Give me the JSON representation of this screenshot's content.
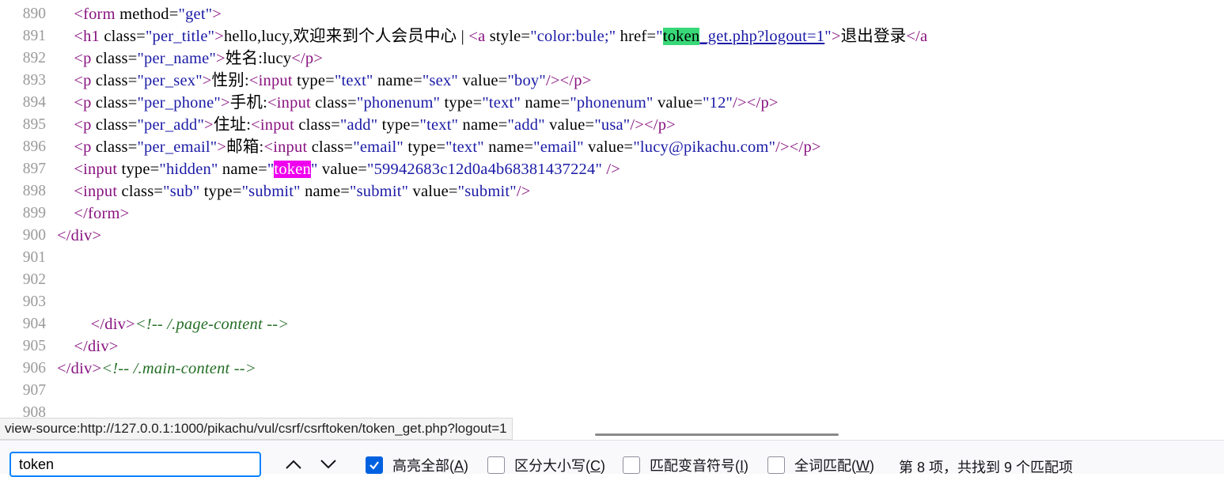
{
  "source_lines": [
    {
      "num": "890",
      "parts": [
        [
          "text",
          "    "
        ],
        [
          "tag",
          "<form "
        ],
        [
          "an",
          "method="
        ],
        [
          "av",
          "\"get\""
        ],
        [
          "tag",
          ">"
        ]
      ]
    },
    {
      "num": "891",
      "parts": [
        [
          "text",
          "    "
        ],
        [
          "tag",
          "<h1 "
        ],
        [
          "an",
          "class="
        ],
        [
          "av",
          "\"per_title\""
        ],
        [
          "tag",
          ">"
        ],
        [
          "text",
          "hello,lucy,欢迎来到个人会员中心 | "
        ],
        [
          "tag",
          "<a "
        ],
        [
          "an",
          "style="
        ],
        [
          "av",
          "\"color:bule;\" "
        ],
        [
          "an",
          "href="
        ],
        [
          "av",
          "\""
        ],
        [
          "hlcur",
          "token"
        ],
        [
          "link",
          "_get.php?logout=1"
        ],
        [
          "av",
          "\""
        ],
        [
          "tag",
          ">"
        ],
        [
          "text",
          "退出登录"
        ],
        [
          "tag",
          "</a"
        ]
      ]
    },
    {
      "num": "892",
      "parts": [
        [
          "text",
          "    "
        ],
        [
          "tag",
          "<p "
        ],
        [
          "an",
          "class="
        ],
        [
          "av",
          "\"per_name\""
        ],
        [
          "tag",
          ">"
        ],
        [
          "text",
          "姓名:lucy"
        ],
        [
          "tag",
          "</p>"
        ]
      ]
    },
    {
      "num": "893",
      "parts": [
        [
          "text",
          "    "
        ],
        [
          "tag",
          "<p "
        ],
        [
          "an",
          "class="
        ],
        [
          "av",
          "\"per_sex\""
        ],
        [
          "tag",
          ">"
        ],
        [
          "text",
          "性别:"
        ],
        [
          "tag",
          "<input "
        ],
        [
          "an",
          "type="
        ],
        [
          "av",
          "\"text\" "
        ],
        [
          "an",
          "name="
        ],
        [
          "av",
          "\"sex\" "
        ],
        [
          "an",
          "value="
        ],
        [
          "av",
          "\"boy\""
        ],
        [
          "tag",
          "/></p>"
        ]
      ]
    },
    {
      "num": "894",
      "parts": [
        [
          "text",
          "    "
        ],
        [
          "tag",
          "<p "
        ],
        [
          "an",
          "class="
        ],
        [
          "av",
          "\"per_phone\""
        ],
        [
          "tag",
          ">"
        ],
        [
          "text",
          "手机:"
        ],
        [
          "tag",
          "<input "
        ],
        [
          "an",
          "class="
        ],
        [
          "av",
          "\"phonenum\" "
        ],
        [
          "an",
          "type="
        ],
        [
          "av",
          "\"text\" "
        ],
        [
          "an",
          "name="
        ],
        [
          "av",
          "\"phonenum\" "
        ],
        [
          "an",
          "value="
        ],
        [
          "av",
          "\"12\""
        ],
        [
          "tag",
          "/></p>"
        ]
      ]
    },
    {
      "num": "895",
      "parts": [
        [
          "text",
          "    "
        ],
        [
          "tag",
          "<p "
        ],
        [
          "an",
          "class="
        ],
        [
          "av",
          "\"per_add\""
        ],
        [
          "tag",
          ">"
        ],
        [
          "text",
          "住址:"
        ],
        [
          "tag",
          "<input "
        ],
        [
          "an",
          "class="
        ],
        [
          "av",
          "\"add\" "
        ],
        [
          "an",
          "type="
        ],
        [
          "av",
          "\"text\" "
        ],
        [
          "an",
          "name="
        ],
        [
          "av",
          "\"add\" "
        ],
        [
          "an",
          "value="
        ],
        [
          "av",
          "\"usa\""
        ],
        [
          "tag",
          "/></p>"
        ]
      ]
    },
    {
      "num": "896",
      "parts": [
        [
          "text",
          "    "
        ],
        [
          "tag",
          "<p "
        ],
        [
          "an",
          "class="
        ],
        [
          "av",
          "\"per_email\""
        ],
        [
          "tag",
          ">"
        ],
        [
          "text",
          "邮箱:"
        ],
        [
          "tag",
          "<input "
        ],
        [
          "an",
          "class="
        ],
        [
          "av",
          "\"email\" "
        ],
        [
          "an",
          "type="
        ],
        [
          "av",
          "\"text\" "
        ],
        [
          "an",
          "name="
        ],
        [
          "av",
          "\"email\" "
        ],
        [
          "an",
          "value="
        ],
        [
          "av",
          "\"lucy@pikachu.com\""
        ],
        [
          "tag",
          "/></p>"
        ]
      ]
    },
    {
      "num": "897",
      "parts": [
        [
          "text",
          "    "
        ],
        [
          "tag",
          "<input "
        ],
        [
          "an",
          "type="
        ],
        [
          "av",
          "\"hidden\" "
        ],
        [
          "an",
          "name="
        ],
        [
          "av",
          "\""
        ],
        [
          "hlsel",
          "token"
        ],
        [
          "av",
          "\" "
        ],
        [
          "an",
          "value="
        ],
        [
          "av",
          "\"59942683c12d0a4b68381437224\" "
        ],
        [
          "tag",
          "/>"
        ]
      ]
    },
    {
      "num": "898",
      "parts": [
        [
          "text",
          "    "
        ],
        [
          "tag",
          "<input "
        ],
        [
          "an",
          "class="
        ],
        [
          "av",
          "\"sub\" "
        ],
        [
          "an",
          "type="
        ],
        [
          "av",
          "\"submit\" "
        ],
        [
          "an",
          "name="
        ],
        [
          "av",
          "\"submit\" "
        ],
        [
          "an",
          "value="
        ],
        [
          "av",
          "\"submit\""
        ],
        [
          "tag",
          "/>"
        ]
      ]
    },
    {
      "num": "899",
      "parts": [
        [
          "text",
          "    "
        ],
        [
          "tag",
          "</form>"
        ]
      ]
    },
    {
      "num": "900",
      "parts": [
        [
          "tag",
          "</div>"
        ]
      ]
    },
    {
      "num": "901",
      "parts": []
    },
    {
      "num": "902",
      "parts": []
    },
    {
      "num": "903",
      "parts": []
    },
    {
      "num": "904",
      "parts": [
        [
          "text",
          "        "
        ],
        [
          "tag",
          "</div>"
        ],
        [
          "cm",
          "<!-- /.page-content -->"
        ]
      ]
    },
    {
      "num": "905",
      "parts": [
        [
          "text",
          "    "
        ],
        [
          "tag",
          "</div>"
        ]
      ]
    },
    {
      "num": "906",
      "parts": [
        [
          "tag",
          "</div>"
        ],
        [
          "cm",
          "<!-- /.main-content -->"
        ]
      ]
    },
    {
      "num": "907",
      "parts": []
    },
    {
      "num": "908",
      "parts": []
    }
  ],
  "status_url": "view-source:http://127.0.0.1:1000/pikachu/vul/csrf/csrftoken/token_get.php?logout=1",
  "findbar": {
    "query": "token",
    "prev_icon": "chevron-up-icon",
    "next_icon": "chevron-down-icon",
    "highlight_all": {
      "label": "高亮全部(",
      "key": "A",
      "close": ")",
      "checked": true
    },
    "match_case": {
      "label": "区分大小写(",
      "key": "C",
      "close": ")",
      "checked": false
    },
    "match_diacritics": {
      "label": "匹配变音符号(",
      "key": "I",
      "close": ")",
      "checked": false
    },
    "whole_words": {
      "label": "全词匹配(",
      "key": "W",
      "close": ")",
      "checked": false
    },
    "result": "第 8 项，共找到 9 个匹配项"
  },
  "colors": {
    "tag": "#881280",
    "attr_value": "#1a1aa6",
    "comment": "#236e25",
    "current_match": "#38d878",
    "selected_match": "#ef00ef",
    "accent": "#0a84ff",
    "checkbox_on": "#0061e0"
  }
}
